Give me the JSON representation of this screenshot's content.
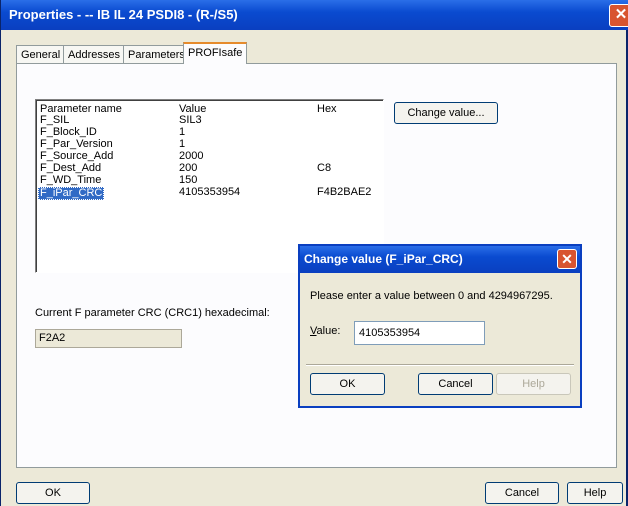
{
  "window": {
    "title": "Properties - -- IB IL 24 PSDI8 - (R-/S5)",
    "close_glyph": "✕"
  },
  "tabs": [
    {
      "label": "General"
    },
    {
      "label": "Addresses"
    },
    {
      "label": "Parameters"
    },
    {
      "label": "PROFIsafe"
    }
  ],
  "list": {
    "columns": [
      "Parameter name",
      "Value",
      "Hex"
    ],
    "rows": [
      {
        "name": "F_SIL",
        "value": "SIL3",
        "hex": ""
      },
      {
        "name": "F_Block_ID",
        "value": "1",
        "hex": ""
      },
      {
        "name": "F_Par_Version",
        "value": "1",
        "hex": ""
      },
      {
        "name": "F_Source_Add",
        "value": "2000",
        "hex": ""
      },
      {
        "name": "F_Dest_Add",
        "value": "200",
        "hex": "C8"
      },
      {
        "name": "F_WD_Time",
        "value": "150",
        "hex": ""
      },
      {
        "name": "F_iPar_CRC",
        "value": "4105353954",
        "hex": "F4B2BAE2"
      }
    ]
  },
  "change_value_button": "Change value...",
  "crc": {
    "label": "Current F parameter CRC (CRC1) hexadecimal:",
    "value": "F2A2"
  },
  "dialog": {
    "title": "Change value (F_iPar_CRC)",
    "close_glyph": "✕",
    "message": "Please enter a value between 0 and  4294967295.",
    "value_label_u": "V",
    "value_label_rest": "alue:",
    "value": "4105353954",
    "ok": "OK",
    "cancel": "Cancel",
    "help": "Help"
  },
  "footer": {
    "ok": "OK",
    "cancel": "Cancel",
    "help": "Help"
  }
}
